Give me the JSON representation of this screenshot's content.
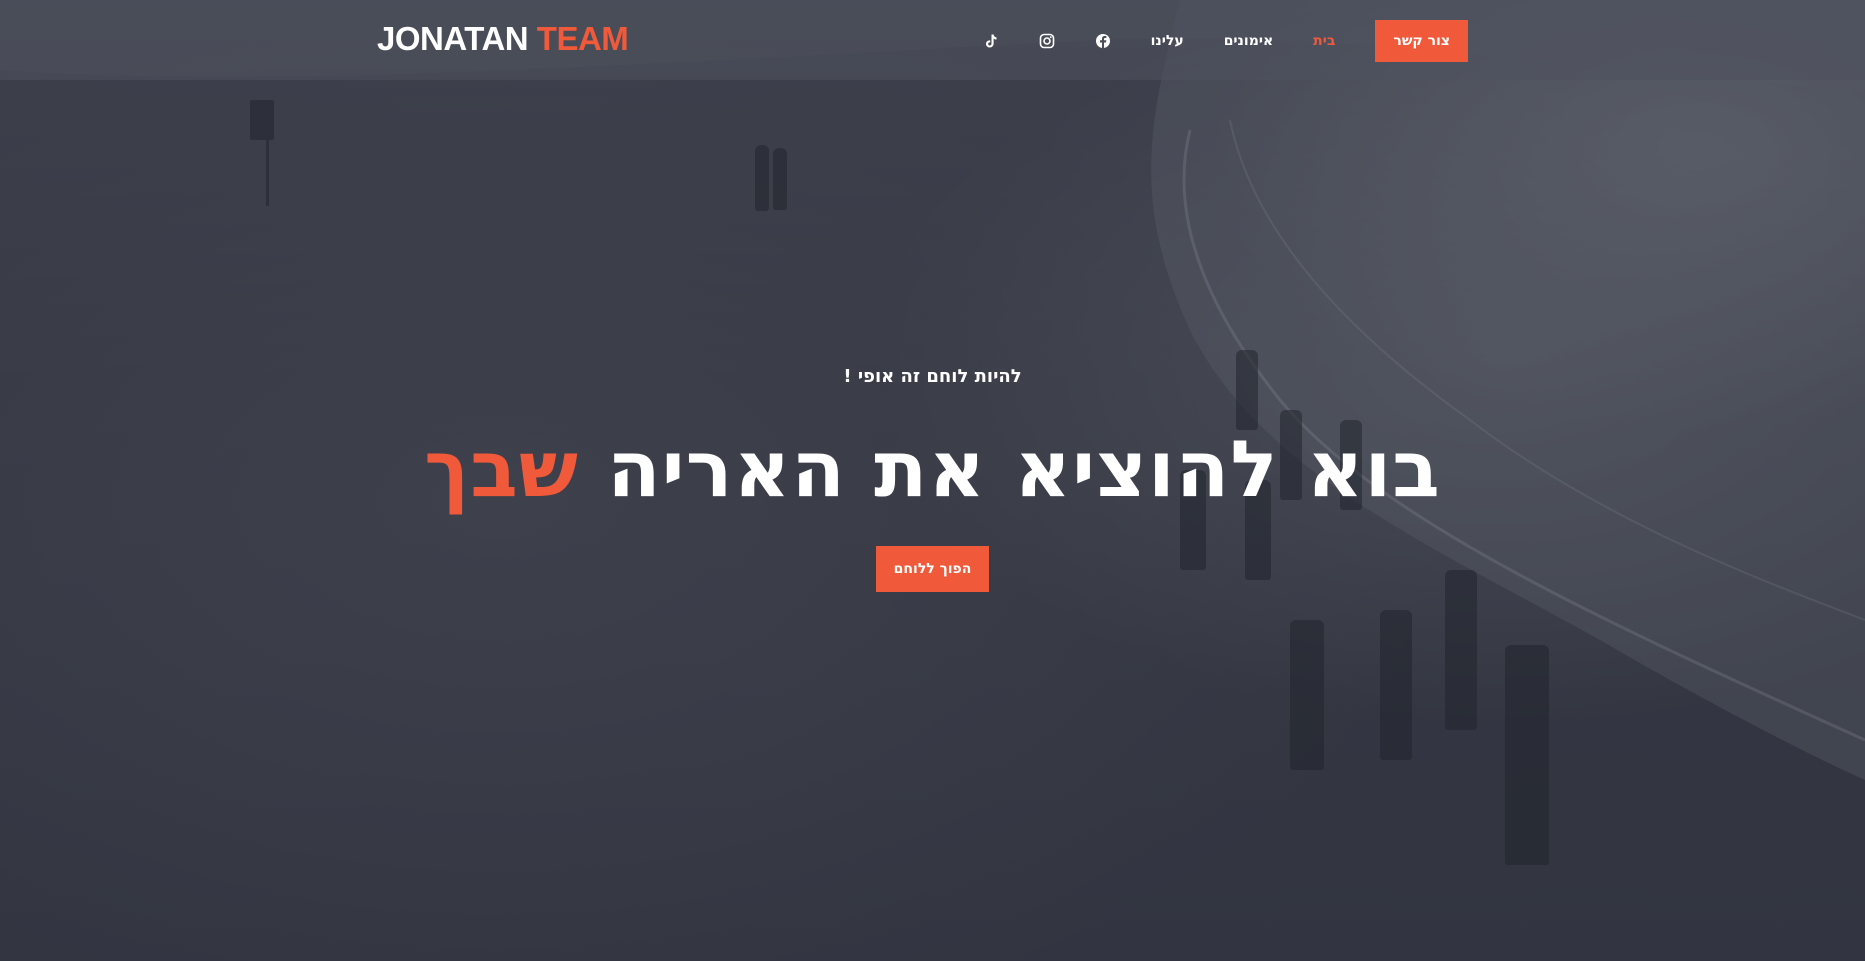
{
  "brand": {
    "word1": "JONATAN",
    "word2": "TEAM",
    "accent_color": "#f05a3a"
  },
  "nav": {
    "cta_label": "צור קשר",
    "items": [
      {
        "label": "בית",
        "active": true
      },
      {
        "label": "אימונים",
        "active": false
      },
      {
        "label": "עלינו",
        "active": false
      }
    ],
    "social_icons": [
      "facebook-icon",
      "instagram-icon",
      "tiktok-icon"
    ]
  },
  "hero": {
    "subtitle": "להיות לוחם זה אופי !",
    "headline_main": "בוא להוציא את האריה ",
    "headline_accent": "שבך",
    "button_label": "הפוך ללוחם"
  }
}
